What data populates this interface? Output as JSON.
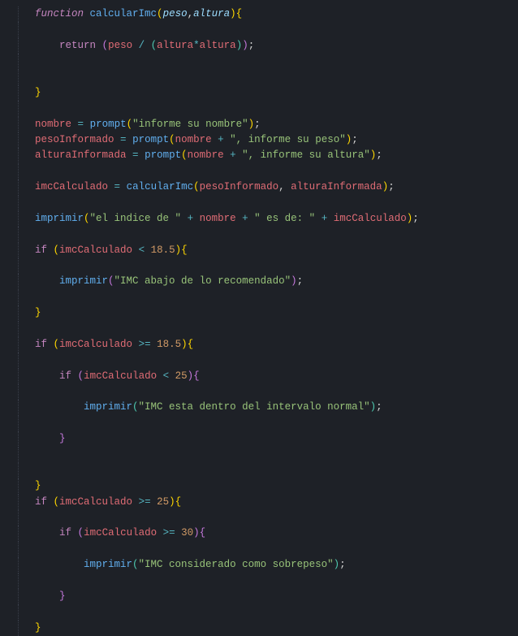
{
  "tokens": {
    "function": "function",
    "return": "return",
    "if": "if",
    "calcularImc": "calcularImc",
    "peso": "peso",
    "altura": "altura",
    "nombre": "nombre",
    "pesoInformado": "pesoInformado",
    "alturaInformada": "alturaInformada",
    "imcCalculado": "imcCalculado",
    "prompt": "prompt",
    "imprimir": "imprimir",
    "str_nombre": "\"informe su nombre\"",
    "str_peso": "\", informe su peso\"",
    "str_altura": "\", informe su altura\"",
    "str_indice": "\"el indice de \"",
    "str_esde": "\" es de: \"",
    "str_abajo": "\"IMC abajo de lo recomendado\"",
    "str_normal": "\"IMC esta dentro del intervalo normal\"",
    "str_sobre": "\"IMC considerado como sobrepeso\"",
    "n18_5": "18.5",
    "n25": "25",
    "n30": "30",
    "lt": "<",
    "gte": ">=",
    "eq": "=",
    "plus": "+",
    "slash": "/",
    "star": "*",
    "comma": ",",
    "semi": ";",
    "lparen": "(",
    "rparen": ")",
    "lbrace": "{",
    "rbrace": "}"
  }
}
